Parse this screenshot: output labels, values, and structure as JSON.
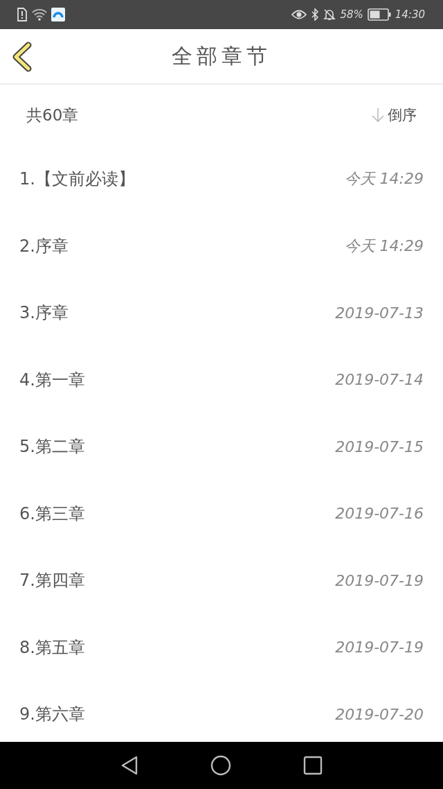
{
  "status_bar": {
    "battery_percent": "58%",
    "time": "14:30"
  },
  "header": {
    "title": "全部章节"
  },
  "summary": {
    "count": "共60章",
    "sort_label": "倒序"
  },
  "chapters": [
    {
      "title": "1.【文前必读】",
      "date": "今天 14:29"
    },
    {
      "title": "2.序章",
      "date": "今天 14:29"
    },
    {
      "title": "3.序章",
      "date": "2019-07-13"
    },
    {
      "title": "4.第一章",
      "date": "2019-07-14"
    },
    {
      "title": "5.第二章",
      "date": "2019-07-15"
    },
    {
      "title": "6.第三章",
      "date": "2019-07-16"
    },
    {
      "title": "7.第四章",
      "date": "2019-07-19"
    },
    {
      "title": "8.第五章",
      "date": "2019-07-19"
    },
    {
      "title": "9.第六章",
      "date": "2019-07-20"
    }
  ]
}
